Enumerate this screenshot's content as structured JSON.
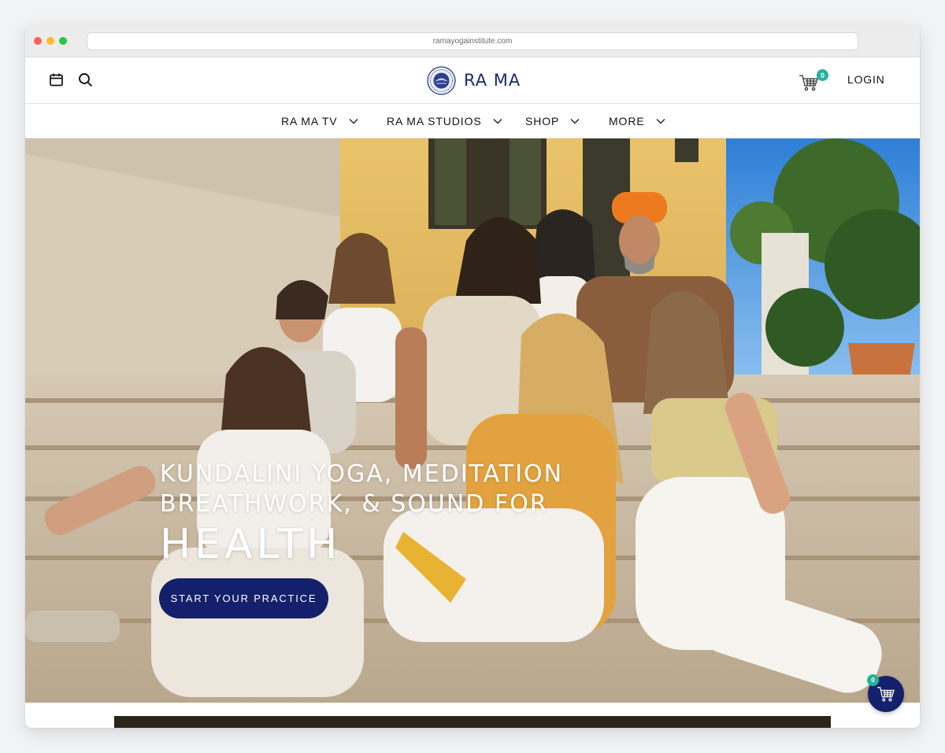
{
  "browser": {
    "url": "ramayogainstitute.com"
  },
  "header": {
    "logo_text": "RA MA",
    "login_label": "LOGIN",
    "cart_count": "0",
    "icons": [
      "calendar-icon",
      "search-icon",
      "cart-icon"
    ]
  },
  "nav": {
    "items": [
      {
        "label": "RA MA TV"
      },
      {
        "label": "RA MA STUDIOS"
      },
      {
        "label": "SHOP"
      },
      {
        "label": "MORE"
      }
    ]
  },
  "hero": {
    "line1": "KUNDALINI YOGA, MEDITATION",
    "line2": "BREATHWORK, & SOUND FOR",
    "highlight": "HEALTH",
    "cta_label": "START YOUR PRACTICE"
  },
  "floating_cart": {
    "count": "0"
  },
  "colors": {
    "brand_navy": "#14206b",
    "badge_teal": "#21b39a",
    "logo_blue": "#1b2a6b"
  }
}
